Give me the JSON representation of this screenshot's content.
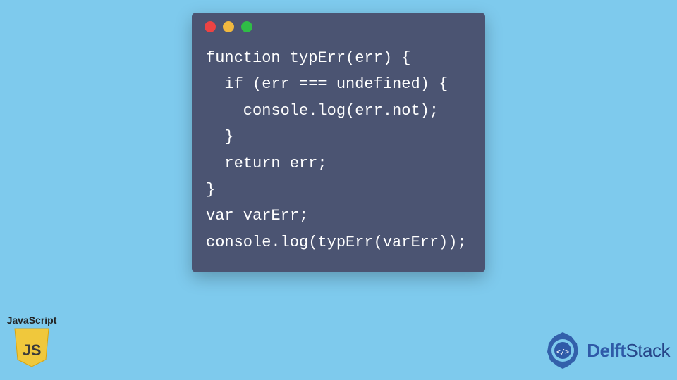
{
  "window": {
    "dots": {
      "red": "#ed4343",
      "yellow": "#f0b83f",
      "green": "#2fbd46"
    }
  },
  "code": {
    "lines": [
      "function typErr(err) {",
      "  if (err === undefined) {",
      "    console.log(err.not);",
      "  }",
      "  return err;",
      "}",
      "var varErr;",
      "console.log(typErr(varErr));"
    ]
  },
  "js_badge": {
    "label": "JavaScript",
    "icon_text": "JS"
  },
  "brand": {
    "name_prefix": "Delft",
    "name_suffix": "Stack"
  }
}
